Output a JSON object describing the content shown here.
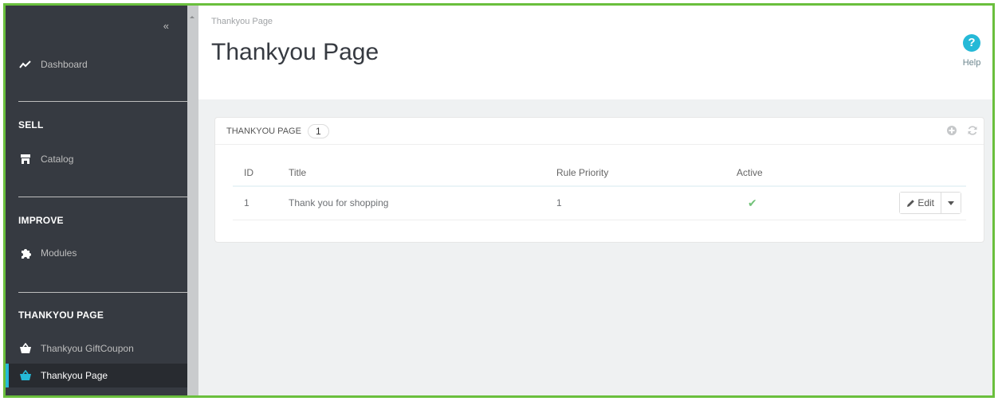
{
  "sidebar": {
    "collapse_label": "«",
    "dashboard": {
      "label": "Dashboard",
      "icon": "trending-up-icon"
    },
    "sections": [
      {
        "title": "SELL",
        "items": [
          {
            "label": "Catalog",
            "icon": "store-icon"
          }
        ]
      },
      {
        "title": "IMPROVE",
        "items": [
          {
            "label": "Modules",
            "icon": "puzzle-icon"
          }
        ]
      },
      {
        "title": "THANKYOU PAGE",
        "items": [
          {
            "label": "Thankyou GiftCoupon",
            "icon": "basket-icon"
          },
          {
            "label": "Thankyou Page",
            "icon": "basket-icon",
            "active": true
          }
        ]
      }
    ]
  },
  "header": {
    "breadcrumb": "Thankyou Page",
    "title": "Thankyou Page",
    "help_label": "Help",
    "help_glyph": "?"
  },
  "panel": {
    "title": "THANKYOU PAGE",
    "count": "1",
    "columns": {
      "id": "ID",
      "title": "Title",
      "priority": "Rule Priority",
      "active": "Active"
    },
    "rows": [
      {
        "id": "1",
        "title": "Thank you for shopping",
        "priority": "1",
        "active": "✔",
        "edit_label": "Edit"
      }
    ]
  },
  "colors": {
    "accent": "#25b9d7",
    "sidebar_bg": "#363a41",
    "frame_border": "#6abf3d",
    "active_check": "#72c279"
  }
}
